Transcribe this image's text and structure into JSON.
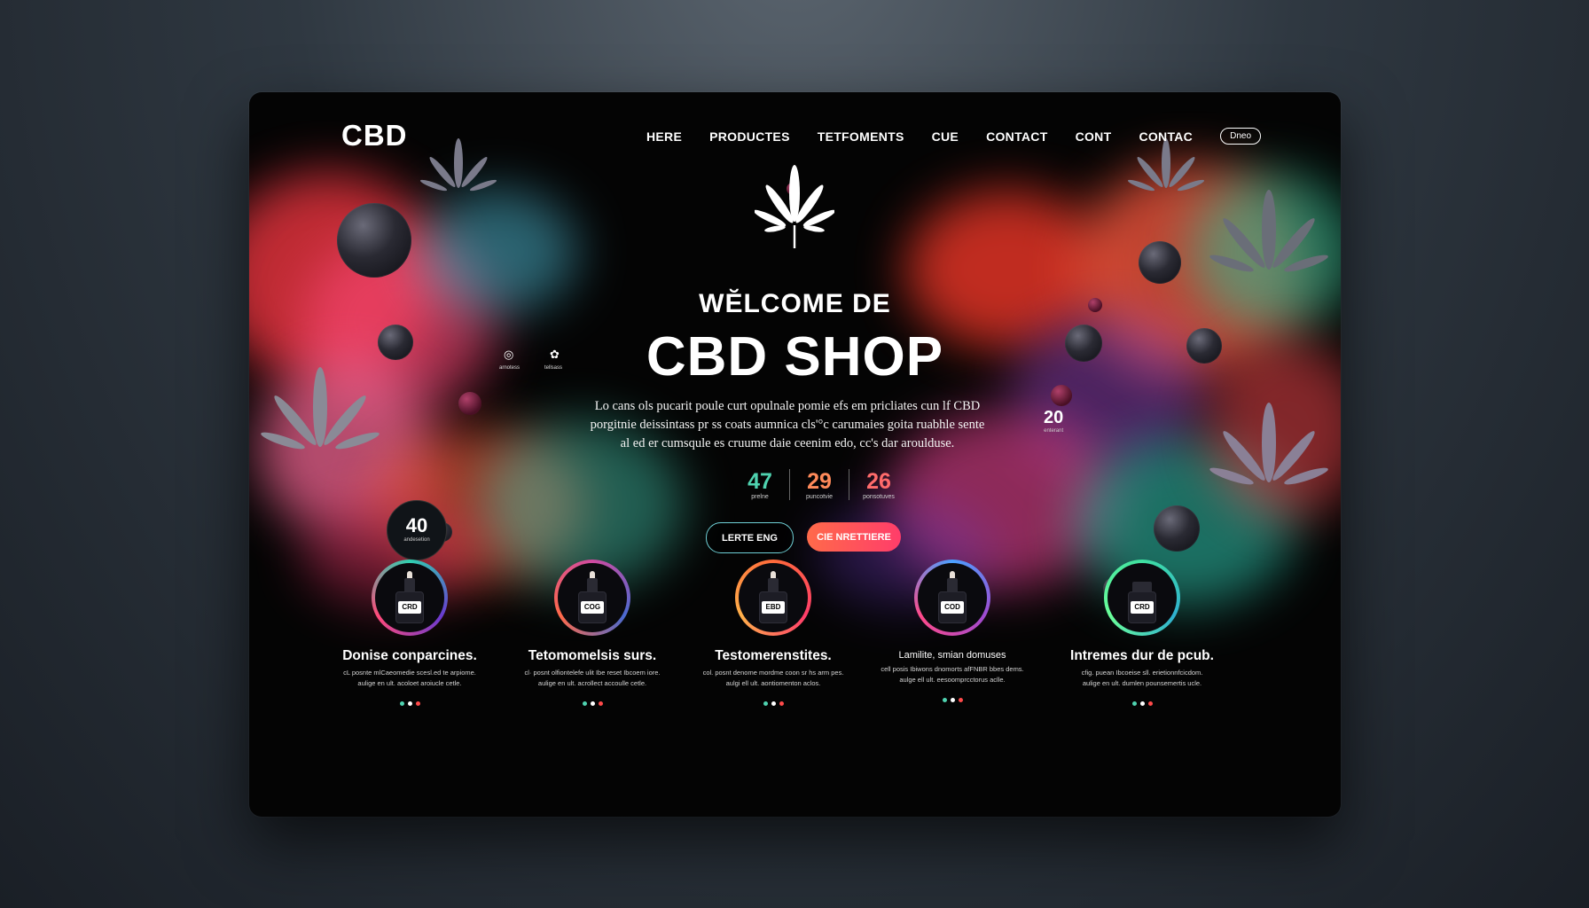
{
  "brand": "CBD",
  "nav": {
    "items": [
      "HERE",
      "PRODUCTES",
      "TETFOMENTS",
      "CUE",
      "CONTACT",
      "CONT",
      "CONTAC"
    ],
    "pill": "Dneo"
  },
  "hero": {
    "welcome": "WĔLCOME DE",
    "title": "CBD SHOP",
    "desc": "Lo cans ols pucarit poule curt opulnale pomie efs em pricliates cun lf CBD porgitnie deissintass pr ss coats aumnica cls'°c carumaies goita ruabhle sente al ed er cumsqule es cruume daie ceenim edo, cc's dar aroulduse.",
    "badge_left": {
      "num": "40",
      "label": "andesetion"
    },
    "badge_right": {
      "num": "20",
      "label": "enterant"
    },
    "mini_icons": [
      {
        "label": "arnotess"
      },
      {
        "label": "tellsass"
      }
    ]
  },
  "stats": [
    {
      "num": "47",
      "label": "prelne",
      "color": "#4fd3b0"
    },
    {
      "num": "29",
      "label": "puncotvie",
      "color": "#ff8a5a"
    },
    {
      "num": "26",
      "label": "ponsotuves",
      "color": "#ff6b6b"
    }
  ],
  "buttons": {
    "primary": "LERTE ENG",
    "secondary": "CIE NRETTIERE"
  },
  "products": [
    {
      "label": "CRD",
      "title": "Donise conparcines.",
      "text1": "cL posnte mlCaeomedie scesl.ed te arpiome.",
      "text2": "aulige en ult. acoloet aroiucle cetle.",
      "ring": "#2fd0b0"
    },
    {
      "label": "COG",
      "title": "Tetomomelsis surs.",
      "text1": "cl· posnt olfiontelefe ulit Ibe reset Ibcoem iore.",
      "text2": "aulige en ult. acrollect accoulle cetle.",
      "ring": "#d04aa0"
    },
    {
      "label": "EBD",
      "title": "Testomerenstites.",
      "text1": "col. posnt denome mordme coon sr hs arm pes.",
      "text2": "aulgi ell ult. aontiomenton aclos.",
      "ring": "#ff6a3a"
    },
    {
      "label": "COD",
      "title": "Lamilite, smian domuses",
      "text1": "cell posis Ibiwons dnomorts afFNBR bbes dems.",
      "text2": "aulge ell ult. eesoomprcctorus aclle.",
      "ring": "#4aa0ff"
    },
    {
      "label": "CRD",
      "title": "Intremes dur de pcub.",
      "text1": "cfig. puean Ibcoeise sll. erietionnfcicdom.",
      "text2": "aulige en ult. dumlen pounsemertis ucle.",
      "ring": "#3fe0a0"
    }
  ],
  "colors": {
    "accent_teal": "#4fd3b0",
    "accent_orange": "#ff6a4a",
    "accent_pink": "#ff3d6a"
  }
}
